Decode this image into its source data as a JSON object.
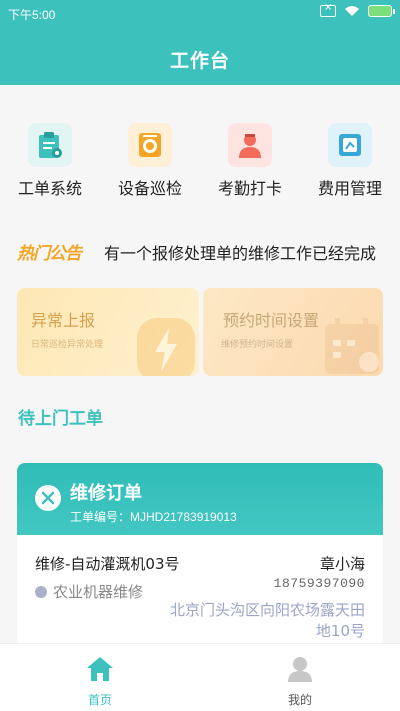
{
  "status_bar": {
    "time": "下午5:00"
  },
  "header": {
    "title": "工作台"
  },
  "quick_menu": [
    {
      "label": "工单系统",
      "icon": "clipboard-icon",
      "color": "#3cc1bd",
      "bg": "#e3f5f3"
    },
    {
      "label": "设备巡检",
      "icon": "inspect-icon",
      "color": "#f5a524",
      "bg": "#fdf0d7"
    },
    {
      "label": "考勤打卡",
      "icon": "worker-icon",
      "color": "#f36b5b",
      "bg": "#fde4e1"
    },
    {
      "label": "费用管理",
      "icon": "finance-icon",
      "color": "#37a8d6",
      "bg": "#dff1f9"
    }
  ],
  "notice": {
    "tag": "热门公告",
    "text": "有一个报修处理单的维修工作已经完成"
  },
  "cards": {
    "left": {
      "title": "异常上报",
      "subtitle": "日常巡检异常处理"
    },
    "right": {
      "title": "预约时间设置",
      "subtitle": "维修预约时间设置"
    }
  },
  "section": {
    "title": "待上门工单"
  },
  "order": {
    "title": "维修订单",
    "number": "工单编号：MJHD21783919013",
    "machine": "维修-自动灌溉机03号",
    "person": "章小海",
    "phone": "18759397090",
    "type": "农业机器维修",
    "address": "北京门头沟区向阳农场露天田地10号"
  },
  "tabbar": {
    "home": "首页",
    "me": "我的"
  },
  "colors": {
    "primary": "#3cc1bd",
    "notice_tag": "#f5a524"
  }
}
